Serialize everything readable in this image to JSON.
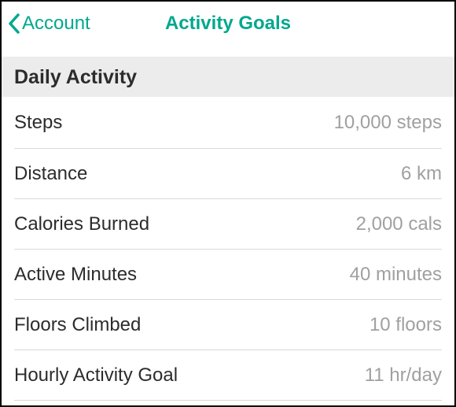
{
  "nav": {
    "back_label": "Account",
    "title": "Activity Goals"
  },
  "section": {
    "header": "Daily Activity"
  },
  "goals": [
    {
      "label": "Steps",
      "value": "10,000 steps"
    },
    {
      "label": "Distance",
      "value": "6 km"
    },
    {
      "label": "Calories Burned",
      "value": "2,000 cals"
    },
    {
      "label": "Active Minutes",
      "value": "40 minutes"
    },
    {
      "label": "Floors Climbed",
      "value": "10 floors"
    },
    {
      "label": "Hourly Activity Goal",
      "value": "11 hr/day"
    }
  ]
}
